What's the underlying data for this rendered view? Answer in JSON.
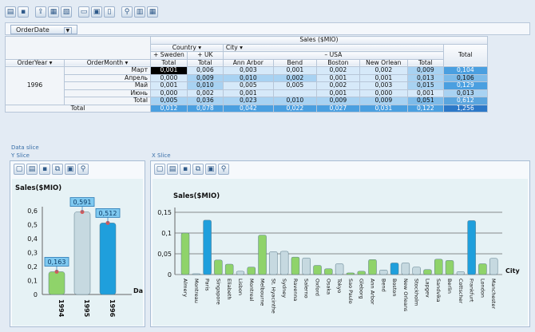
{
  "toolbar": {
    "icons": [
      "open-icon",
      "save-icon",
      "export-icon",
      "export-excel-icon",
      "export-pdf-icon",
      "print-preview-icon",
      "print-icon",
      "page-setup-icon",
      "zoom-icon",
      "chart-icon",
      "grid-icon"
    ]
  },
  "filter_field": {
    "label": "OrderDate",
    "dropdown": "▼"
  },
  "pivot": {
    "measure_label": "Sales ($MIO)",
    "col_field_1": "Country",
    "col_field_2": "City",
    "row_field_1": "OrderYear",
    "row_field_2": "OrderMonth",
    "country_sweden": "Sweden",
    "country_uk": "UK",
    "country_usa": "USA",
    "plus1": "+",
    "plus2": "+",
    "minus1": "–",
    "col_total": "Total",
    "col_headers": [
      "Total",
      "Total",
      "Ann Arbor",
      "Bend",
      "Boston",
      "New Orlean",
      "Total"
    ],
    "year": "1996",
    "rows": [
      {
        "month": "Март",
        "vals": [
          "0,001",
          "0,006",
          "0,003",
          "0,001",
          "0,002",
          "0,002",
          "0,009",
          "0,104"
        ]
      },
      {
        "month": "Апрель",
        "vals": [
          "0,000",
          "0,009",
          "0,010",
          "0,002",
          "0,001",
          "0,001",
          "0,013",
          "0,106"
        ]
      },
      {
        "month": "Май",
        "vals": [
          "0,001",
          "0,010",
          "0,005",
          "0,005",
          "0,002",
          "0,003",
          "0,015",
          "0,129"
        ]
      },
      {
        "month": "Июнь",
        "vals": [
          "0,000",
          "0,002",
          "0,001",
          "",
          "0,001",
          "0,000",
          "0,001",
          "0,013"
        ]
      },
      {
        "month": "Total",
        "vals": [
          "0,005",
          "0,036",
          "0,023",
          "0,010",
          "0,009",
          "0,009",
          "0,051",
          "0,612"
        ]
      }
    ],
    "grand_label": "Total",
    "grand_vals": [
      "0,012",
      "0,078",
      "0,042",
      "0,022",
      "0,027",
      "0,031",
      "0,122",
      "1,256"
    ]
  },
  "data_slice_label": "Data slice",
  "y_slice_label": "Y Slice",
  "x_slice_label": "X Slice",
  "chart_data": [
    {
      "type": "bar",
      "title": "Sales($MIO)",
      "xlabel": "Date",
      "categories": [
        "1994",
        "1995",
        "1996"
      ],
      "values": [
        0.163,
        0.591,
        0.512
      ],
      "data_labels": [
        "0,163",
        "0,591",
        "0,512"
      ],
      "ylim": [
        0,
        0.6
      ],
      "yticks": [
        "0",
        "0,1",
        "0,2",
        "0,3",
        "0,4",
        "0,5",
        "0,6"
      ],
      "colors": [
        "#8fd36a",
        "#c6d9e0",
        "#1f9fdc"
      ]
    },
    {
      "type": "bar",
      "title": "Sales($MIO)",
      "xlabel": "City",
      "ylim": [
        0,
        0.15
      ],
      "yticks": [
        "0",
        "0,05",
        "0,1",
        "0,15"
      ],
      "categories": [
        "Almery",
        "Montreau",
        "Paris",
        "Singapore",
        "Eliabeth",
        "Lisbon",
        "Montreal",
        "Melbourne",
        "St. Hyacinthe",
        "Sydney",
        "Ravenna",
        "Salerno",
        "Oxford",
        "Osaka",
        "Tokyo",
        "Sao Paulo",
        "Gleborg",
        "Ann Arbor",
        "Bend",
        "Boston",
        "New Orleans",
        "Stockholm",
        "Lapgev",
        "Sandvika",
        "Berlin",
        "Cottscher",
        "Frankfurt",
        "London",
        "Manchester"
      ],
      "values": [
        0.1,
        0.002,
        0.131,
        0.035,
        0.025,
        0.008,
        0.018,
        0.095,
        0.055,
        0.056,
        0.042,
        0.04,
        0.022,
        0.014,
        0.026,
        0.004,
        0.008,
        0.036,
        0.011,
        0.028,
        0.028,
        0.018,
        0.012,
        0.037,
        0.034,
        0.007,
        0.13,
        0.026,
        0.039
      ],
      "colors": [
        "#8fd36a",
        "#c6d9e0",
        "#1f9fdc",
        "#8fd36a",
        "#8fd36a",
        "#c6d9e0",
        "#8fd36a",
        "#8fd36a",
        "#c6d9e0",
        "#c6d9e0",
        "#8fd36a",
        "#c6d9e0",
        "#8fd36a",
        "#8fd36a",
        "#c6d9e0",
        "#8fd36a",
        "#8fd36a",
        "#8fd36a",
        "#c6d9e0",
        "#1f9fdc",
        "#c6d9e0",
        "#c6d9e0",
        "#8fd36a",
        "#8fd36a",
        "#8fd36a",
        "#c6d9e0",
        "#1f9fdc",
        "#8fd36a",
        "#c6d9e0"
      ]
    }
  ]
}
